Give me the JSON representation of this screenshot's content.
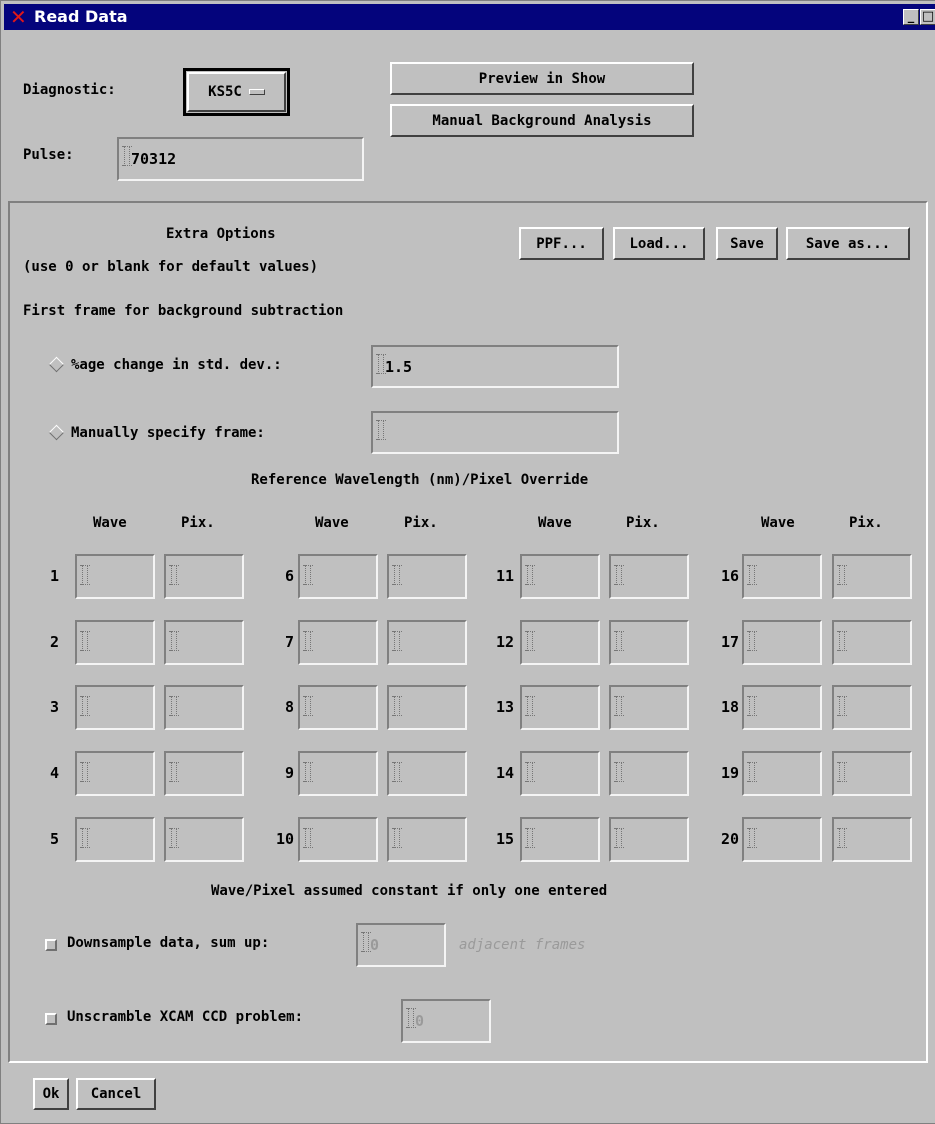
{
  "window": {
    "title": "Read Data",
    "controls": {
      "minimize": "_",
      "maximize": "□",
      "close": "✕"
    }
  },
  "top": {
    "diagnostic_label": "Diagnostic:",
    "diagnostic_value": "KS5C",
    "preview_button": "Preview in Show",
    "manual_bg_button": "Manual Background Analysis",
    "pulse_label": "Pulse:",
    "pulse_value": "70312"
  },
  "extra": {
    "title": "Extra Options",
    "subtitle": "(use 0 or blank for default values)",
    "buttons": {
      "ppf": "PPF...",
      "load": "Load...",
      "save": "Save",
      "save_as": "Save as..."
    },
    "first_frame_label": "First frame for background subtraction",
    "radio_pct_label": "%age change in std. dev.:",
    "radio_pct_value": "1.5",
    "radio_manual_label": "Manually specify frame:",
    "radio_manual_value": "",
    "ref_title": "Reference Wavelength (nm)/Pixel Override",
    "col_wave": "Wave",
    "col_pix": "Pix.",
    "row_numbers": [
      [
        "1",
        "6",
        "11",
        "16"
      ],
      [
        "2",
        "7",
        "12",
        "17"
      ],
      [
        "3",
        "8",
        "13",
        "18"
      ],
      [
        "4",
        "9",
        "14",
        "19"
      ],
      [
        "5",
        "10",
        "15",
        "20"
      ]
    ],
    "constant_note": "Wave/Pixel assumed constant if only one entered",
    "downsample_label": "Downsample data, sum up:",
    "downsample_value": "0",
    "downsample_suffix": "adjacent frames",
    "unscramble_label": "Unscramble XCAM CCD problem:",
    "unscramble_value": "0"
  },
  "bottom": {
    "ok": "Ok",
    "cancel": "Cancel"
  },
  "colors": {
    "titlebar": "#04047c",
    "face": "#c0c0c0",
    "close_x": "#e01818"
  }
}
